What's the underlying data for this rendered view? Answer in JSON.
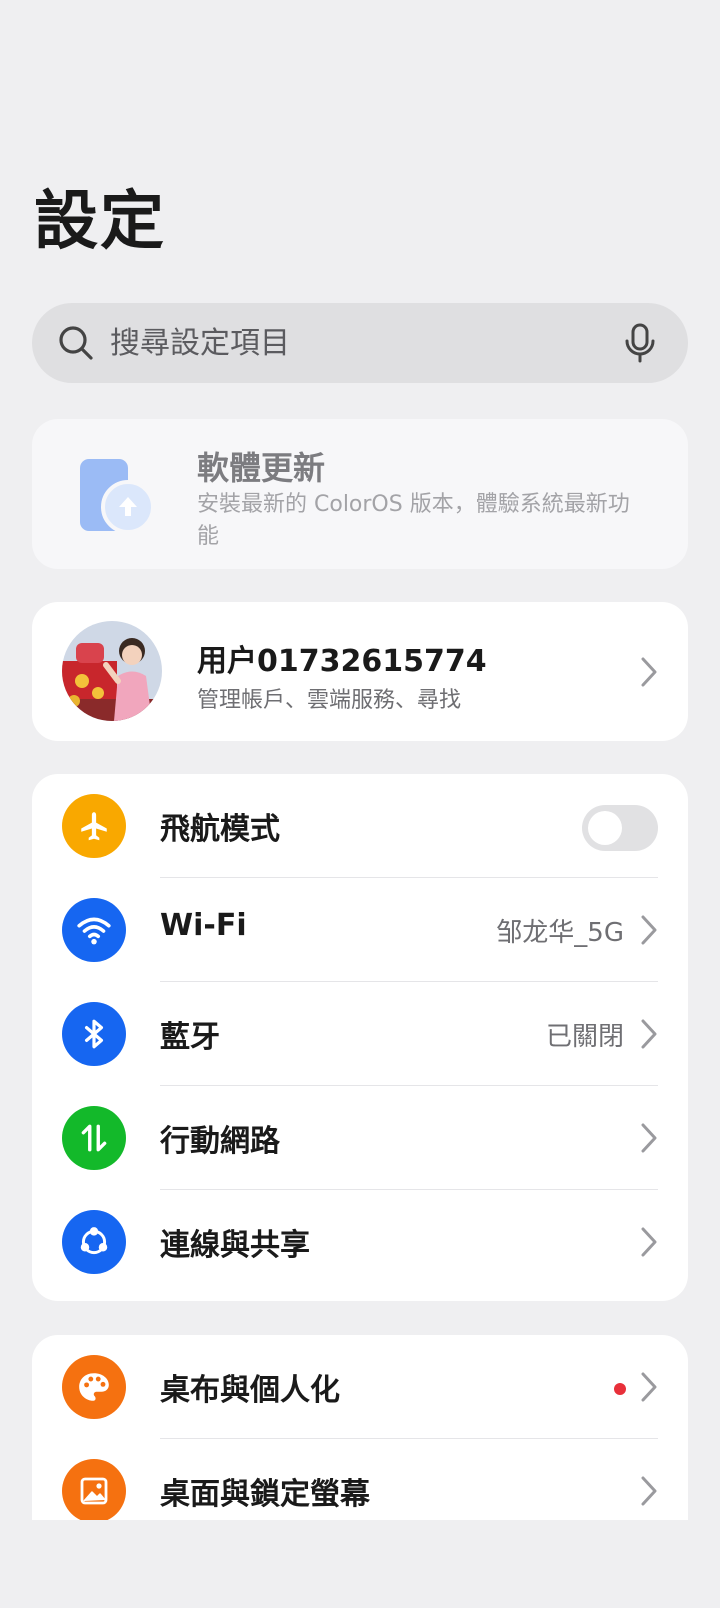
{
  "page_title": "設定",
  "search": {
    "placeholder": "搜尋設定項目",
    "icon": "search-icon",
    "mic_icon": "microphone-icon"
  },
  "update": {
    "title": "軟體更新",
    "subtitle": "安裝最新的 ColorOS 版本，體驗系統最新功能"
  },
  "account": {
    "name": "用户01732615774",
    "subtitle": "管理帳戶、雲端服務、尋找"
  },
  "network": [
    {
      "label": "飛航模式",
      "icon": "airplane-icon",
      "color": "#f9a800",
      "toggle": false
    },
    {
      "label": "Wi-Fi",
      "icon": "wifi-icon",
      "color": "#1666f1",
      "value": "邹龙华_5G"
    },
    {
      "label": "藍牙",
      "icon": "bluetooth-icon",
      "color": "#1666f1",
      "value": "已關閉"
    },
    {
      "label": "行動網路",
      "icon": "mobile-data-icon",
      "color": "#13b92a"
    },
    {
      "label": "連線與共享",
      "icon": "share-icon",
      "color": "#1666f1"
    }
  ],
  "personal": [
    {
      "label": "桌布與個人化",
      "icon": "palette-icon",
      "color": "#f57110",
      "badge": true
    },
    {
      "label": "桌面與鎖定螢幕",
      "icon": "wallpaper-icon",
      "color": "#f57110"
    }
  ],
  "colors": {
    "background": "#efeff1",
    "card": "#ffffff",
    "badge_red": "#e8303a"
  }
}
